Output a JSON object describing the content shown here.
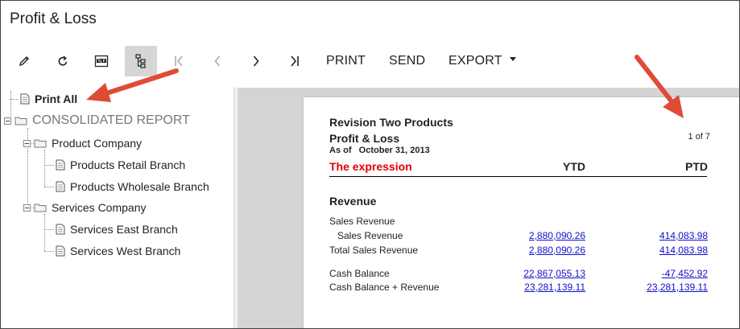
{
  "window": {
    "title": "Profit & Loss"
  },
  "toolbar": {
    "icons": [
      "edit-icon",
      "refresh-icon",
      "pdf-icon",
      "tree-toggle-icon",
      "first-page-icon",
      "previous-page-icon",
      "next-page-icon",
      "last-page-icon"
    ],
    "print_label": "PRINT",
    "send_label": "SEND",
    "export_label": "EXPORT"
  },
  "tree": {
    "print_all": "Print All",
    "root": "CONSOLIDATED REPORT",
    "companies": [
      {
        "label": "Product Company",
        "branches": [
          "Products Retail Branch",
          "Products Wholesale Branch"
        ]
      },
      {
        "label": "Services Company",
        "branches": [
          "Services East Branch",
          "Services West Branch"
        ]
      }
    ]
  },
  "report": {
    "company": "Revision Two Products",
    "name": "Profit & Loss",
    "as_of": "As of   October 31, 2013",
    "page": "1 of 7",
    "expression_label": "The expression",
    "col_ytd": "YTD",
    "col_ptd": "PTD",
    "section": "Revenue",
    "rows": [
      {
        "label": "Sales Revenue",
        "ytd": "",
        "ptd": ""
      },
      {
        "label": "   Sales Revenue",
        "ytd": "2,880,090.26",
        "ptd": "414,083.98"
      },
      {
        "label": "Total Sales Revenue",
        "ytd": "2,880,090.26",
        "ptd": "414,083.98"
      },
      {
        "label": "Cash Balance",
        "ytd": "22,867,055.13",
        "ptd": "-47,452.92"
      },
      {
        "label": "Cash Balance + Revenue",
        "ytd": "23,281,139.11",
        "ptd": "23,281,139.11"
      }
    ]
  },
  "annotations": {
    "arrow_color": "#e04b35"
  }
}
